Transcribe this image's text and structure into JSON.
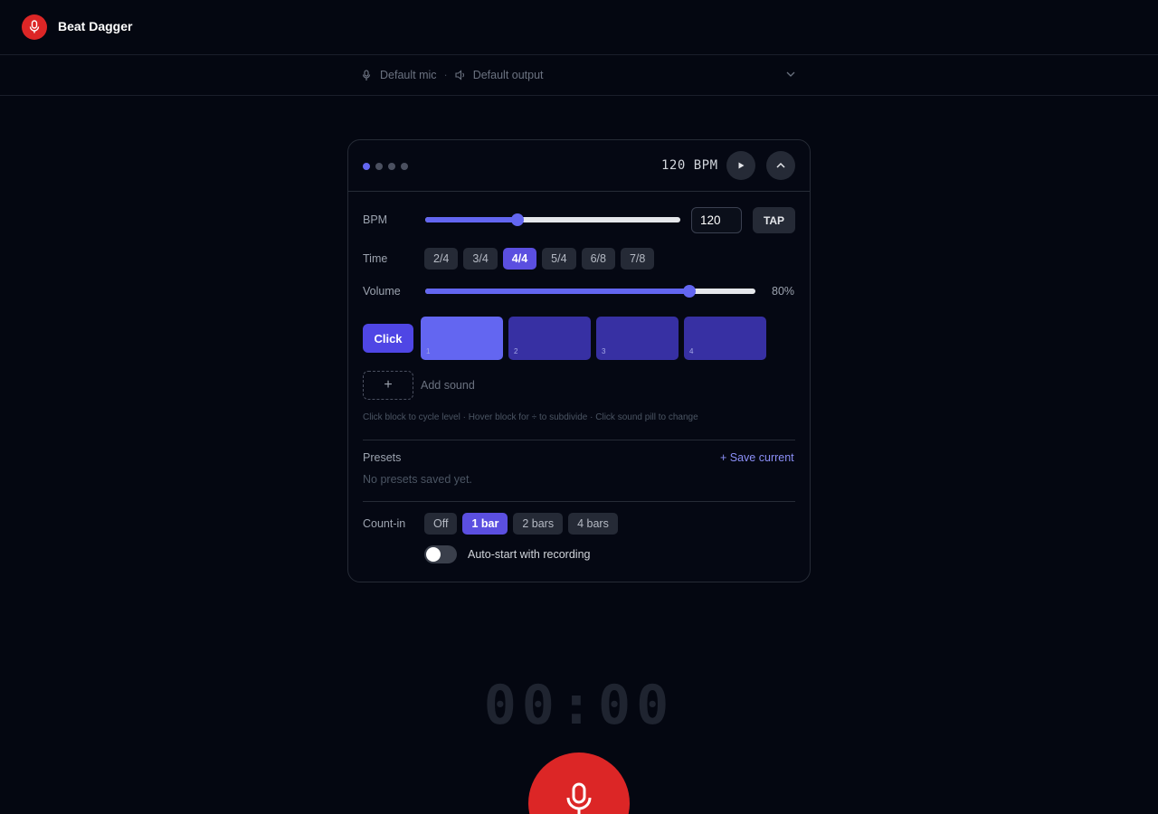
{
  "app": {
    "title": "Beat Dagger"
  },
  "devices": {
    "mic": "Default mic",
    "separator": "·",
    "output": "Default output"
  },
  "metronome": {
    "header": {
      "bpm_display": "120 BPM"
    },
    "page_dots": 4,
    "bpm": {
      "label": "BPM",
      "value": "120",
      "slider_fraction": 0.36,
      "tap_label": "TAP"
    },
    "time": {
      "label": "Time",
      "options": [
        "2/4",
        "3/4",
        "4/4",
        "5/4",
        "6/8",
        "7/8"
      ],
      "selected": "4/4"
    },
    "volume": {
      "label": "Volume",
      "value": 0.8,
      "value_text": "80%"
    },
    "sound": {
      "pill_label": "Click",
      "beats": [
        "1",
        "2",
        "3",
        "4"
      ],
      "accent_beat": "1"
    },
    "add_sound": {
      "icon": "+",
      "label": "Add sound"
    },
    "hint": "Click block to cycle level · Hover block for ÷ to subdivide · Click sound pill to change",
    "presets": {
      "label": "Presets",
      "save_label": "+ Save current",
      "empty_text": "No presets saved yet."
    },
    "count_in": {
      "label": "Count-in",
      "options": [
        "Off",
        "1 bar",
        "2 bars",
        "4 bars"
      ],
      "selected": "1 bar"
    },
    "auto_start": {
      "label": "Auto-start with recording",
      "enabled": false
    }
  },
  "recorder": {
    "timer": "00:00"
  },
  "colors": {
    "accent": "#6366f1",
    "record": "#dc2626",
    "background": "#040711"
  }
}
